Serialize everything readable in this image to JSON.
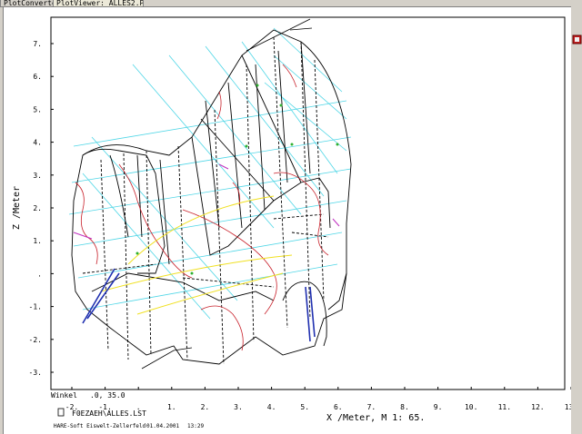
{
  "tabs": [
    {
      "label": "PlotConverter",
      "active": false
    },
    {
      "label": "PlotViewer: ALLES2.PLT",
      "active": true
    }
  ],
  "plot": {
    "z_axis_label": "Z /Meter",
    "z_ticks": [
      "7.",
      "6.",
      "5.",
      "4.",
      "3.",
      "2.",
      "1.",
      ".",
      "-1.",
      "-2.",
      "-3."
    ],
    "x_ticks": [
      "-2.",
      "-1.",
      ".",
      "1.",
      "2.",
      "3.",
      "4.",
      "5.",
      "6.",
      "7.",
      "8.",
      "9.",
      "10.",
      "11.",
      "12.",
      "13."
    ],
    "x_axis_label": "X /Meter, M 1: 65.",
    "winkel_label": "Winkel",
    "winkel_values": ".0,  35.0",
    "file_name": "F0EZAEH\\ALLES.LST",
    "footer_company": "HARE-Soft  Eiswelt-Zellerfeld",
    "footer_date": "01.04.2001",
    "footer_time": "13:29",
    "colors": {
      "cyan_grid": "#4fd6e6",
      "red_detail": "#c8202a",
      "yellow_line": "#f0e020",
      "blue_pillar": "#2030b0",
      "magenta_mark": "#c030c0",
      "green_mark": "#30b030"
    }
  },
  "side_icon": "toolbar-icon"
}
